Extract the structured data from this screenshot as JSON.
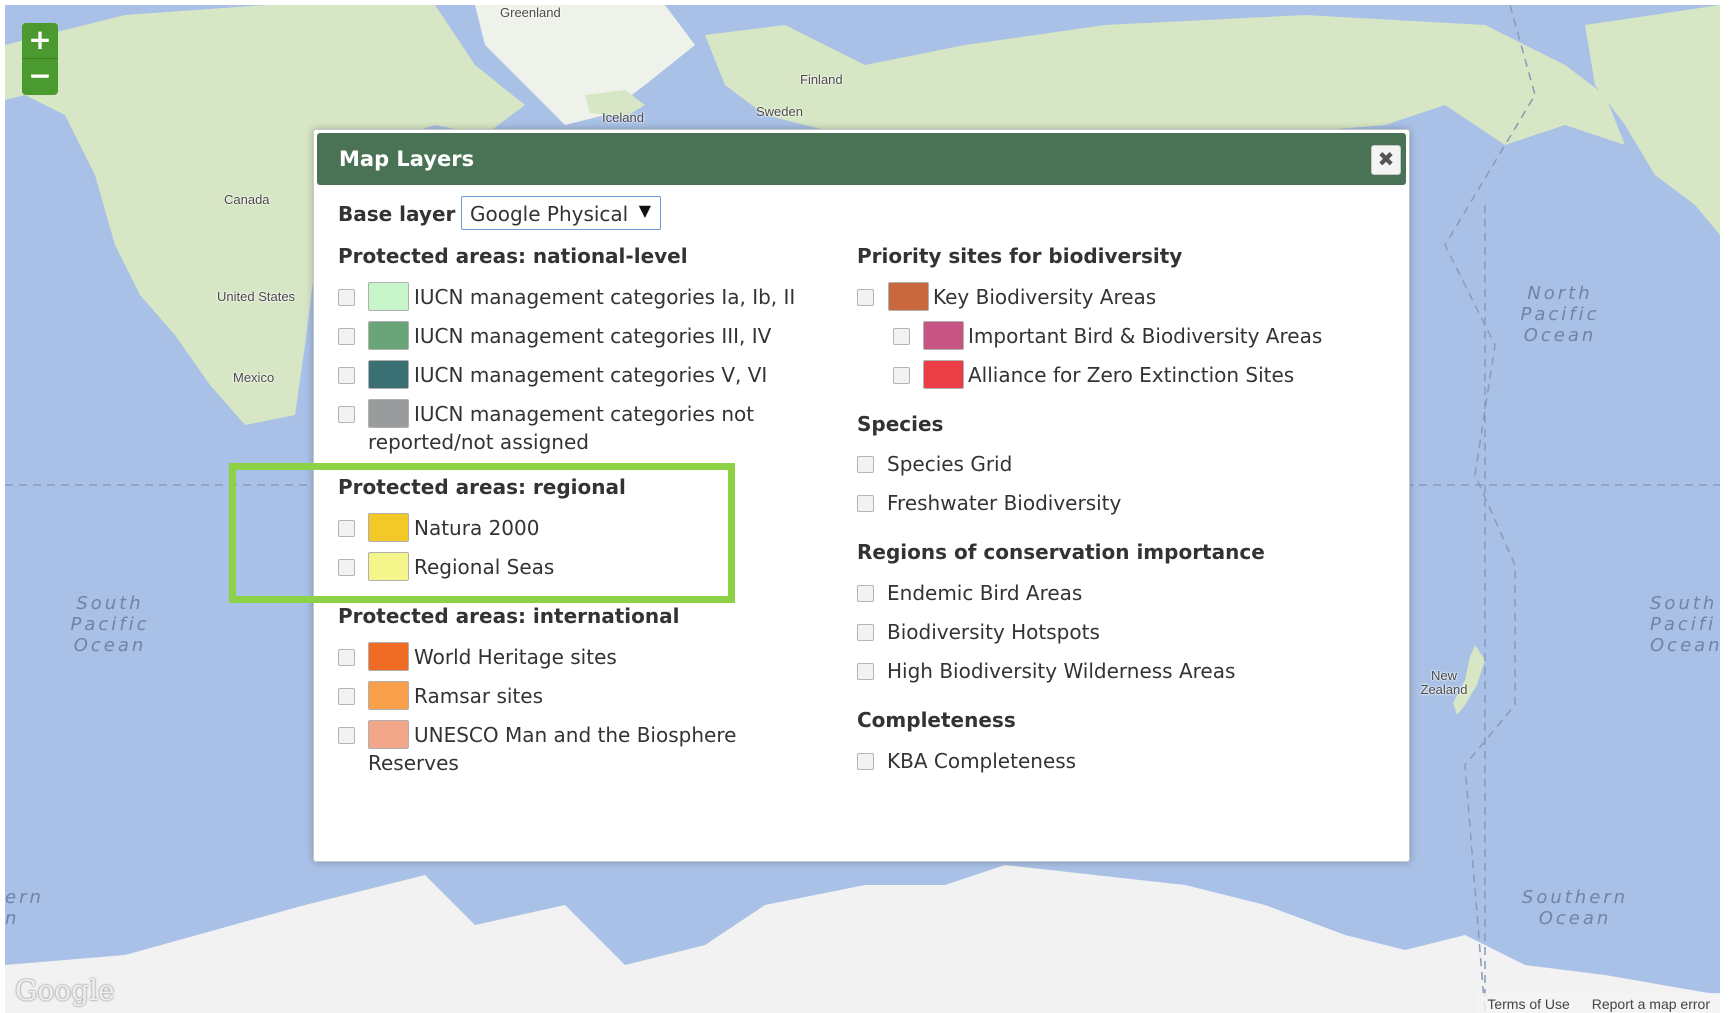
{
  "map": {
    "place_labels": {
      "greenland": "Greenland",
      "finland": "Finland",
      "iceland": "Iceland",
      "sweden": "Sweden",
      "canada": "Canada",
      "united_states": "United States",
      "mexico": "Mexico",
      "new_zealand": "New Zealand"
    },
    "ocean_labels": {
      "north_pacific": "North Pacific Ocean",
      "south_pacific_left": "South Pacific Ocean",
      "south_pacific_right": "South Pacifi Ocean",
      "southern": "Southern Ocean",
      "southern_left_partial": "ern n"
    },
    "zoom": {
      "in": "+",
      "out": "−"
    },
    "logo": "Google",
    "attribution": {
      "terms": "Terms of Use",
      "report": "Report a map error"
    },
    "colors": {
      "water": "#a9c1e6",
      "land": "#d7e6c4",
      "ice": "#f2f2f2",
      "zoom_button": "#4a9a2f"
    }
  },
  "dialog": {
    "title": "Map Layers",
    "close_icon": "close-icon",
    "base_layer": {
      "label": "Base layer",
      "selected": "Google Physical"
    },
    "header_color": "#4a7355",
    "left_column": [
      {
        "title": "Protected areas: national-level",
        "items": [
          {
            "label": "IUCN management categories Ia, Ib, II",
            "color": "#c8f5c9",
            "checked": false
          },
          {
            "label": "IUCN management categories III, IV",
            "color": "#6aa57a",
            "checked": false
          },
          {
            "label": "IUCN management categories V, VI",
            "color": "#3a6f74",
            "checked": false
          },
          {
            "label": "IUCN management categories not reported/not assigned",
            "color": "#9a9b9d",
            "checked": false
          }
        ]
      },
      {
        "title": "Protected areas: regional",
        "items": [
          {
            "label": "Natura 2000",
            "color": "#f2c928",
            "checked": false
          },
          {
            "label": "Regional Seas",
            "color": "#f4f58a",
            "checked": false
          }
        ]
      },
      {
        "title": "Protected areas: international",
        "items": [
          {
            "label": "World Heritage sites",
            "color": "#f06b23",
            "checked": false
          },
          {
            "label": "Ramsar sites",
            "color": "#f79f4b",
            "checked": false
          },
          {
            "label": "UNESCO Man and the Biosphere Reserves",
            "color": "#f2a68a",
            "checked": false
          }
        ]
      }
    ],
    "right_column": [
      {
        "title": "Priority sites for biodiversity",
        "items": [
          {
            "label": "Key Biodiversity Areas",
            "color": "#c9683f",
            "checked": false
          },
          {
            "label": "Important Bird & Biodiversity Areas",
            "color": "#c75583",
            "checked": false
          },
          {
            "label": "Alliance for Zero Extinction Sites",
            "color": "#ea3d46",
            "checked": false
          }
        ]
      },
      {
        "title": "Species",
        "items": [
          {
            "label": "Species Grid",
            "checked": false
          },
          {
            "label": "Freshwater Biodiversity",
            "checked": false
          }
        ]
      },
      {
        "title": "Regions of conservation importance",
        "items": [
          {
            "label": "Endemic Bird Areas",
            "checked": false
          },
          {
            "label": "Biodiversity Hotspots",
            "checked": false
          },
          {
            "label": "High Biodiversity Wilderness Areas",
            "checked": false
          }
        ]
      },
      {
        "title": "Completeness",
        "items": [
          {
            "label": "KBA Completeness",
            "checked": false
          }
        ]
      }
    ]
  },
  "highlight": {
    "color": "#8dd146",
    "target": "Protected areas: regional"
  }
}
